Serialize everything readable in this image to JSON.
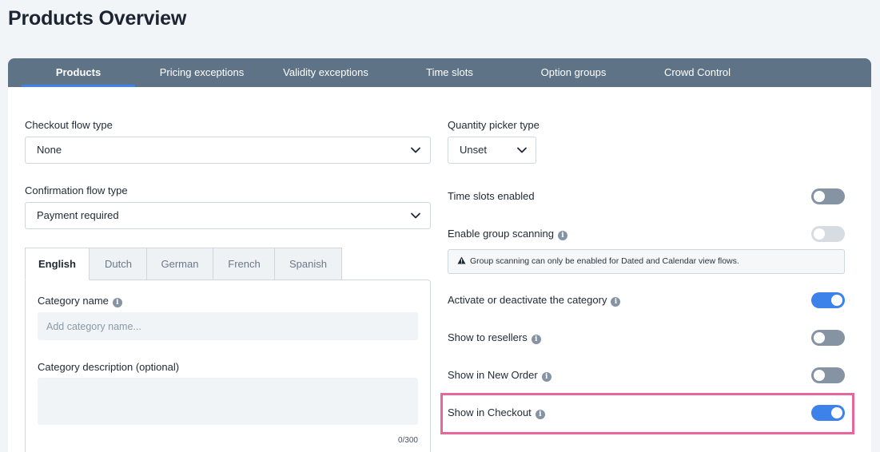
{
  "page": {
    "title": "Products Overview"
  },
  "tabs": [
    {
      "label": "Products",
      "active": true
    },
    {
      "label": "Pricing exceptions"
    },
    {
      "label": "Validity exceptions"
    },
    {
      "label": "Time slots"
    },
    {
      "label": "Option groups"
    },
    {
      "label": "Crowd Control"
    }
  ],
  "left": {
    "checkout_flow": {
      "label": "Checkout flow type",
      "value": "None"
    },
    "confirmation_flow": {
      "label": "Confirmation flow type",
      "value": "Payment required"
    },
    "languages": [
      "English",
      "Dutch",
      "German",
      "French",
      "Spanish"
    ],
    "active_language": "English",
    "category_name": {
      "label": "Category name",
      "placeholder": "Add category name..."
    },
    "category_description": {
      "label": "Category description (optional)",
      "value": "",
      "counter": "0/300"
    }
  },
  "right": {
    "quantity_picker": {
      "label": "Quantity picker type",
      "value": "Unset"
    },
    "time_slots_enabled": {
      "label": "Time slots enabled",
      "state": "off"
    },
    "group_scanning": {
      "label": "Enable group scanning",
      "state": "disabled",
      "warning_icon": "warning-triangle-icon",
      "warning": "Group scanning can only be enabled for Dated and Calendar view flows."
    },
    "activate_category": {
      "label": "Activate or deactivate the category",
      "state": "on"
    },
    "show_resellers": {
      "label": "Show to resellers",
      "state": "off"
    },
    "show_new_order": {
      "label": "Show in New Order",
      "state": "off"
    },
    "show_checkout": {
      "label": "Show in Checkout",
      "state": "on",
      "highlighted": true
    }
  },
  "colors": {
    "tabbar": "#5f7386",
    "accent": "#3d82ea",
    "toggle_off": "#8593a3",
    "toggle_disabled": "#d7dce2",
    "highlight": "#e8679a",
    "background": "#f1f5f8"
  }
}
